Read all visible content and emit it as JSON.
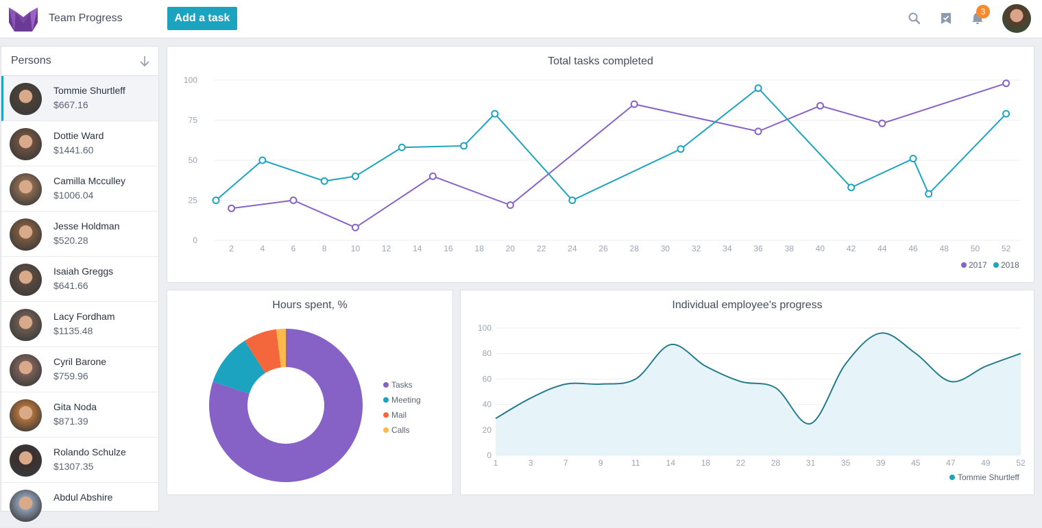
{
  "header": {
    "app_title": "Team Progress",
    "add_task_label": "Add a task",
    "notification_count": "3",
    "icons": [
      "search-icon",
      "bookmark-check-icon",
      "bell-icon",
      "user-avatar"
    ]
  },
  "persons": {
    "title": "Persons",
    "sort_icon": "arrow-down-icon",
    "items": [
      {
        "name": "Tommie Shurtleff",
        "amount": "$667.16",
        "active": true,
        "color": "#4a4038"
      },
      {
        "name": "Dottie Ward",
        "amount": "$1441.60",
        "color": "#6b5040"
      },
      {
        "name": "Camilla Mcculley",
        "amount": "$1006.04",
        "color": "#8a6a50"
      },
      {
        "name": "Jesse Holdman",
        "amount": "$520.28",
        "color": "#7a5a40"
      },
      {
        "name": "Isaiah Greggs",
        "amount": "$641.66",
        "color": "#5a4a40"
      },
      {
        "name": "Lacy Fordham",
        "amount": "$1135.48",
        "color": "#6a5a50"
      },
      {
        "name": "Cyril Barone",
        "amount": "$759.96",
        "color": "#7a6058"
      },
      {
        "name": "Gita Noda",
        "amount": "$871.39",
        "color": "#b0703a"
      },
      {
        "name": "Rolando Schulze",
        "amount": "$1307.35",
        "color": "#3a3030"
      },
      {
        "name": "Abdul Abshire",
        "amount": "",
        "color": "#8a9ab0"
      }
    ]
  },
  "chart_data": [
    {
      "type": "line",
      "title": "Total tasks completed",
      "xlabel": "",
      "ylabel": "",
      "ylim": [
        0,
        100
      ],
      "xlim": [
        1,
        52
      ],
      "yticks": [
        0,
        25,
        50,
        75,
        100
      ],
      "xticks": [
        2,
        4,
        6,
        8,
        10,
        12,
        14,
        16,
        18,
        20,
        22,
        24,
        26,
        28,
        30,
        32,
        34,
        36,
        38,
        40,
        42,
        44,
        46,
        48,
        50,
        52
      ],
      "grid": true,
      "legend": "bottom-right",
      "series": [
        {
          "name": "2017",
          "color": "#8662c7",
          "x": [
            2,
            6,
            10,
            15,
            20,
            28,
            36,
            40,
            44,
            52
          ],
          "values": [
            20,
            25,
            8,
            40,
            22,
            85,
            68,
            84,
            73,
            98
          ]
        },
        {
          "name": "2018",
          "color": "#1ba3c0",
          "x": [
            1,
            4,
            8,
            10,
            13,
            17,
            19,
            24,
            31,
            36,
            42,
            46,
            47,
            52
          ],
          "values": [
            25,
            50,
            37,
            40,
            58,
            59,
            79,
            25,
            57,
            95,
            33,
            51,
            29,
            79
          ]
        }
      ]
    },
    {
      "type": "pie",
      "title": "Hours spent, %",
      "legend": "right",
      "categories": [
        "Tasks",
        "Meeting",
        "Mail",
        "Calls"
      ],
      "values": [
        80,
        11,
        7,
        2
      ],
      "colors": [
        "#8662c7",
        "#1ba3c0",
        "#f4673c",
        "#fdb94a"
      ]
    },
    {
      "type": "area",
      "title": "Individual employee's progress",
      "ylim": [
        0,
        100
      ],
      "yticks": [
        0,
        20,
        40,
        60,
        80,
        100
      ],
      "grid": true,
      "legend": "bottom-right",
      "categories": [
        "1",
        "3",
        "7",
        "9",
        "11",
        "14",
        "18",
        "22",
        "28",
        "31",
        "35",
        "39",
        "45",
        "47",
        "49",
        "52"
      ],
      "series": [
        {
          "name": "Tommie Shurtleff",
          "color": "#247b8c",
          "fill": "#e6f4fa",
          "legend_color": "#1ba3c0",
          "values": [
            29,
            45,
            56,
            56,
            60,
            87,
            70,
            58,
            53,
            25,
            72,
            96,
            80,
            58,
            70,
            80
          ]
        }
      ]
    }
  ]
}
